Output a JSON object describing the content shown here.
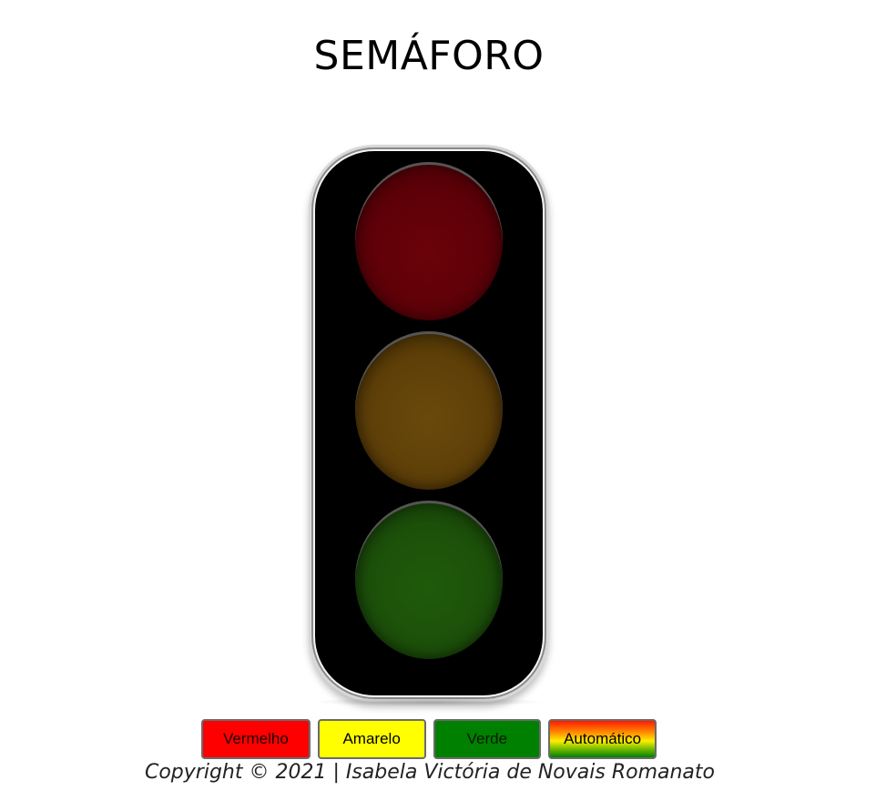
{
  "page": {
    "title": "SEMÁFORO"
  },
  "traffic_light": {
    "lamps": [
      {
        "name": "red",
        "color": "#5e0008",
        "state": "off"
      },
      {
        "name": "yellow",
        "color": "#5e3f08",
        "state": "off"
      },
      {
        "name": "green",
        "color": "#1c500a",
        "state": "off"
      }
    ]
  },
  "controls": {
    "red_label": "Vermelho",
    "yellow_label": "Amarelo",
    "green_label": "Verde",
    "auto_label": "Automático",
    "colors": {
      "red": "#ff0000",
      "yellow": "#ffff00",
      "green": "#008000"
    }
  },
  "footer": {
    "copyright": "Copyright © 2021 | Isabela Victória de Novais Romanato"
  }
}
